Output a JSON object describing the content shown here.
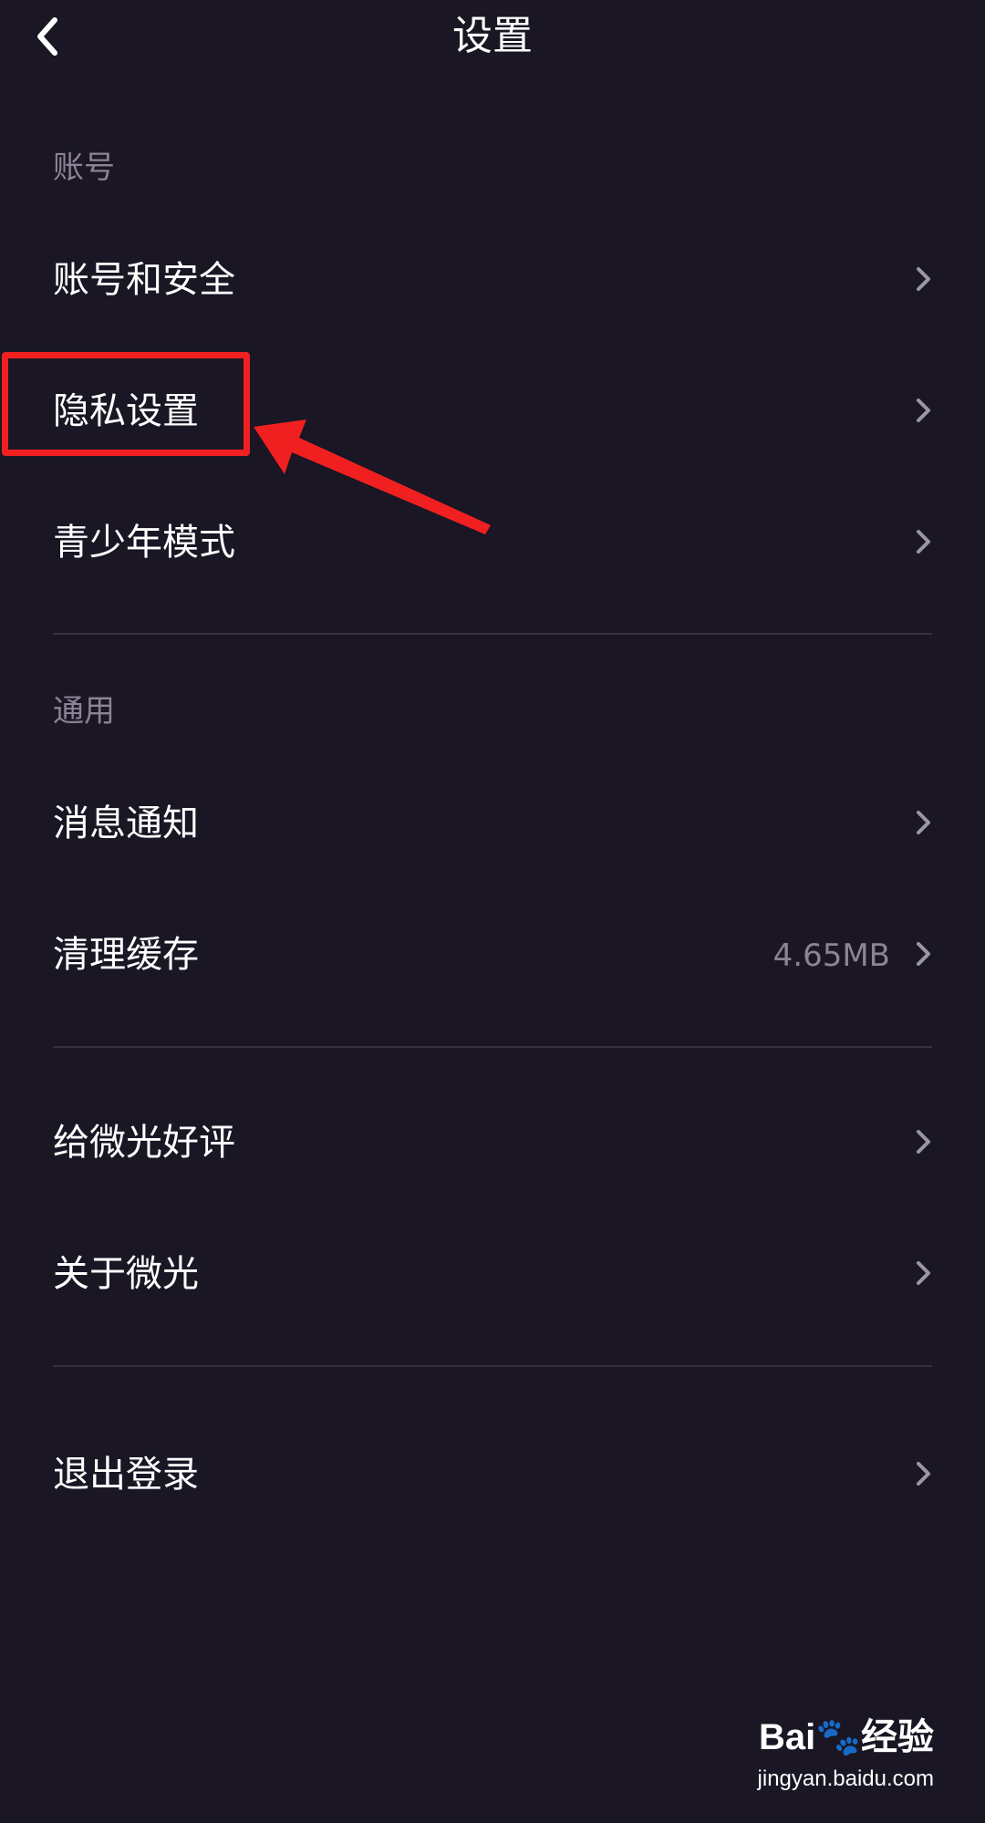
{
  "header": {
    "title": "设置",
    "back_icon": "chevron-left-icon"
  },
  "sections": {
    "account": {
      "label": "账号",
      "items": [
        {
          "label": "账号和安全"
        },
        {
          "label": "隐私设置"
        },
        {
          "label": "青少年模式"
        }
      ]
    },
    "general": {
      "label": "通用",
      "items": [
        {
          "label": "消息通知"
        },
        {
          "label": "清理缓存",
          "value": "4.65MB"
        }
      ]
    },
    "about": {
      "items": [
        {
          "label": "给微光好评"
        },
        {
          "label": "关于微光"
        }
      ]
    },
    "logout": {
      "items": [
        {
          "label": "退出登录"
        }
      ]
    }
  },
  "annotation": {
    "highlighted_item": "隐私设置",
    "color": "#f02020"
  },
  "watermark": {
    "logo": "Bai🐾经验",
    "url": "jingyan.baidu.com"
  },
  "colors": {
    "background": "#1a1624",
    "text_primary": "#ffffff",
    "text_secondary": "#8a8496",
    "divider": "#34303f",
    "chevron": "#9a96a6"
  }
}
